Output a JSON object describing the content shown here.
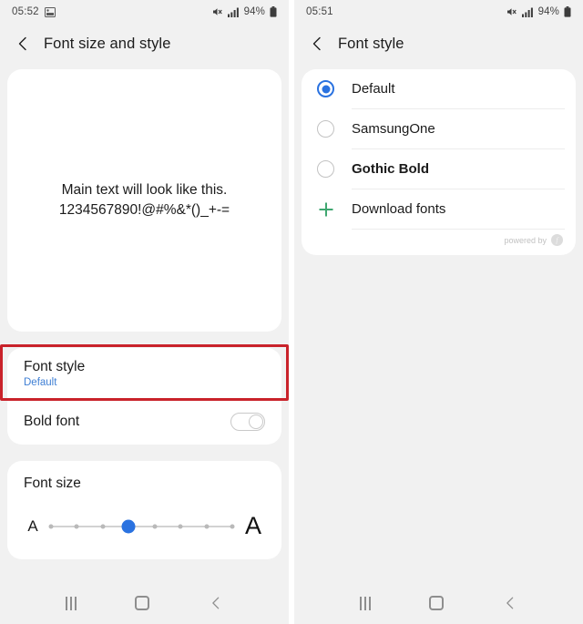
{
  "left_panel": {
    "status_bar": {
      "time": "05:52",
      "icons": [
        "image-icon",
        "volume-mute-icon",
        "signal-bars-icon"
      ],
      "battery_percent": "94%"
    },
    "header": {
      "title": "Font size and style",
      "back_icon": "back-chevron-icon"
    },
    "preview": {
      "line1": "Main text will look like this.",
      "line2": "1234567890!@#%&*()_+-="
    },
    "settings": {
      "font_style": {
        "title": "Font style",
        "value": "Default"
      },
      "bold_font": {
        "title": "Bold font",
        "toggle_state": "off"
      }
    },
    "font_size": {
      "title": "Font size",
      "small_label": "A",
      "large_label": "A",
      "ticks": 8,
      "selected_index": 3
    },
    "highlight_color": "#c9222a"
  },
  "right_panel": {
    "status_bar": {
      "time": "05:51",
      "icons": [
        "volume-mute-icon",
        "signal-bars-icon"
      ],
      "battery_percent": "94%"
    },
    "header": {
      "title": "Font style",
      "back_icon": "back-chevron-icon"
    },
    "font_list": [
      {
        "label": "Default",
        "selected": true,
        "bold": false
      },
      {
        "label": "SamsungOne",
        "selected": false,
        "bold": false
      },
      {
        "label": "Gothic Bold",
        "selected": false,
        "bold": true
      }
    ],
    "download_row": {
      "label": "Download fonts",
      "icon": "plus-icon"
    },
    "footer": {
      "text": "powered by",
      "badge": "f"
    }
  },
  "nav_bar": {
    "recents_label": "recents-icon",
    "home_label": "home-icon",
    "back_label": "back-icon"
  },
  "colors": {
    "accent_blue": "#2a72e0",
    "link_blue": "#3f7fd4",
    "green": "#3fa770",
    "highlight_red": "#c9222a",
    "background": "#f1f1f1",
    "card": "#ffffff"
  }
}
